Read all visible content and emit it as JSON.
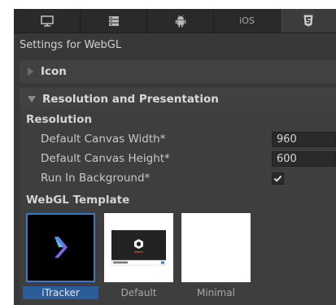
{
  "tabs": [
    {
      "icon": "monitor-icon",
      "label": ""
    },
    {
      "icon": "server-icon",
      "label": ""
    },
    {
      "icon": "android-icon",
      "label": ""
    },
    {
      "icon": "",
      "label": "iOS"
    },
    {
      "icon": "html5-icon",
      "label": ""
    }
  ],
  "settings_title": "Settings for WebGL",
  "icon_section": {
    "label": "Icon"
  },
  "resolution_section": {
    "label": "Resolution and Presentation",
    "resolution_heading": "Resolution",
    "canvas_width_label": "Default Canvas Width*",
    "canvas_width_value": "960",
    "canvas_height_label": "Default Canvas Height*",
    "canvas_height_value": "600",
    "run_in_background_label": "Run In Background*",
    "run_in_background_checked": true,
    "webgl_template_heading": "WebGL Template",
    "templates": [
      {
        "name": "iTracker",
        "selected": true
      },
      {
        "name": "Default",
        "selected": false
      },
      {
        "name": "Minimal",
        "selected": false
      }
    ]
  },
  "colors": {
    "panel_bg": "#383838",
    "selection_blue": "#2c5d9b",
    "selection_border": "#3a79c8"
  }
}
